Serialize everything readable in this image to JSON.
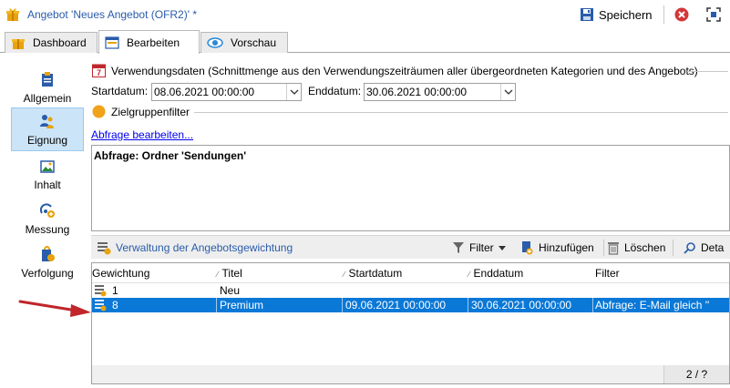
{
  "window": {
    "title": "Angebot 'Neues Angebot (OFR2)' *",
    "save_label": "Speichern"
  },
  "tabs": [
    {
      "label": "Dashboard",
      "icon": "gift-icon"
    },
    {
      "label": "Bearbeiten",
      "icon": "form-icon",
      "active": true
    },
    {
      "label": "Vorschau",
      "icon": "eye-icon"
    }
  ],
  "sidebar": {
    "items": [
      {
        "label": "Allgemein",
        "icon": "clipboard-icon"
      },
      {
        "label": "Eignung",
        "icon": "people-icon",
        "active": true
      },
      {
        "label": "Inhalt",
        "icon": "picture-icon"
      },
      {
        "label": "Messung",
        "icon": "measure-icon"
      },
      {
        "label": "Verfolgung",
        "icon": "tracking-icon"
      }
    ]
  },
  "usage_dates": {
    "header": "Verwendungsdaten (Schnittmenge aus den Verwendungszeiträumen aller übergeordneten Kategorien und des Angebots)",
    "calendar_day": "7",
    "start_label": "Startdatum:",
    "start_value": "08.06.2021 00:00:00",
    "end_label": "Enddatum:",
    "end_value": "30.06.2021 00:00:00"
  },
  "target_filter": {
    "header": "Zielgruppenfilter",
    "edit_link": "Abfrage bearbeiten...",
    "query_text": "Abfrage: Ordner 'Sendungen'"
  },
  "weighting": {
    "title": "Verwaltung der Angebotsgewichtung",
    "filter_label": "Filter",
    "add_label": "Hinzufügen",
    "delete_label": "Löschen",
    "detail_label": "Deta",
    "columns": [
      "Gewichtung",
      "Titel",
      "Startdatum",
      "Enddatum",
      "Filter"
    ],
    "rows": [
      {
        "weight": "1",
        "title": "Neu",
        "start": "",
        "end": "",
        "filter": "",
        "selected": false
      },
      {
        "weight": "8",
        "title": "Premium",
        "start": "09.06.2021 00:00:00",
        "end": "30.06.2021 00:00:00",
        "filter": "Abfrage: E-Mail gleich ''",
        "selected": true
      }
    ],
    "pager": "2 / ?"
  },
  "colors": {
    "accent_text": "#2a5caa",
    "selection": "#0a78d7",
    "arrow": "#c0262b",
    "sidebar_active": "#cce4f7"
  }
}
